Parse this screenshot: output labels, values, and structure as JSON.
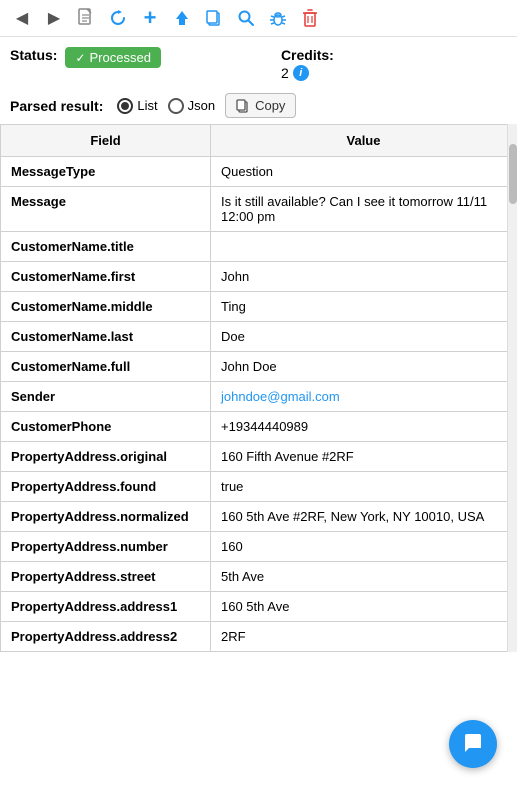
{
  "toolbar": {
    "back_icon": "◀",
    "forward_icon": "▶",
    "doc_icon": "📄",
    "refresh_icon": "↻",
    "add_icon": "+",
    "upload_icon": "▲",
    "copy_icon": "⧉",
    "search_icon": "🔍",
    "bug_icon": "🐛",
    "delete_icon": "🗑"
  },
  "status": {
    "label": "Status:",
    "badge_text": "Processed",
    "checkmark": "✓"
  },
  "credits": {
    "label": "Credits:",
    "value": "2"
  },
  "parsed_result": {
    "label": "Parsed result:",
    "radio_list": "List",
    "radio_json": "Json",
    "copy_label": "Copy"
  },
  "table": {
    "headers": [
      "Field",
      "Value"
    ],
    "rows": [
      {
        "field": "MessageType",
        "value": "Question",
        "is_email": false
      },
      {
        "field": "Message",
        "value": "Is it still available? Can I see it tomorrow 11/11 12:00 pm",
        "is_email": false
      },
      {
        "field": "CustomerName.title",
        "value": "",
        "is_email": false
      },
      {
        "field": "CustomerName.first",
        "value": "John",
        "is_email": false
      },
      {
        "field": "CustomerName.middle",
        "value": "Ting",
        "is_email": false
      },
      {
        "field": "CustomerName.last",
        "value": "Doe",
        "is_email": false
      },
      {
        "field": "CustomerName.full",
        "value": "John Doe",
        "is_email": false
      },
      {
        "field": "Sender",
        "value": "johndoe@gmail.com",
        "is_email": true
      },
      {
        "field": "CustomerPhone",
        "value": "+19344440989",
        "is_email": false
      },
      {
        "field": "PropertyAddress.original",
        "value": "160 Fifth Avenue #2RF",
        "is_email": false
      },
      {
        "field": "PropertyAddress.found",
        "value": "true",
        "is_email": false
      },
      {
        "field": "PropertyAddress.normalized",
        "value": "160 5th Ave #2RF, New York, NY 10010, USA",
        "is_email": false
      },
      {
        "field": "PropertyAddress.number",
        "value": "160",
        "is_email": false
      },
      {
        "field": "PropertyAddress.street",
        "value": "5th Ave",
        "is_email": false
      },
      {
        "field": "PropertyAddress.address1",
        "value": "160 5th Ave",
        "is_email": false
      },
      {
        "field": "PropertyAddress.address2",
        "value": "2RF",
        "is_email": false
      }
    ]
  }
}
